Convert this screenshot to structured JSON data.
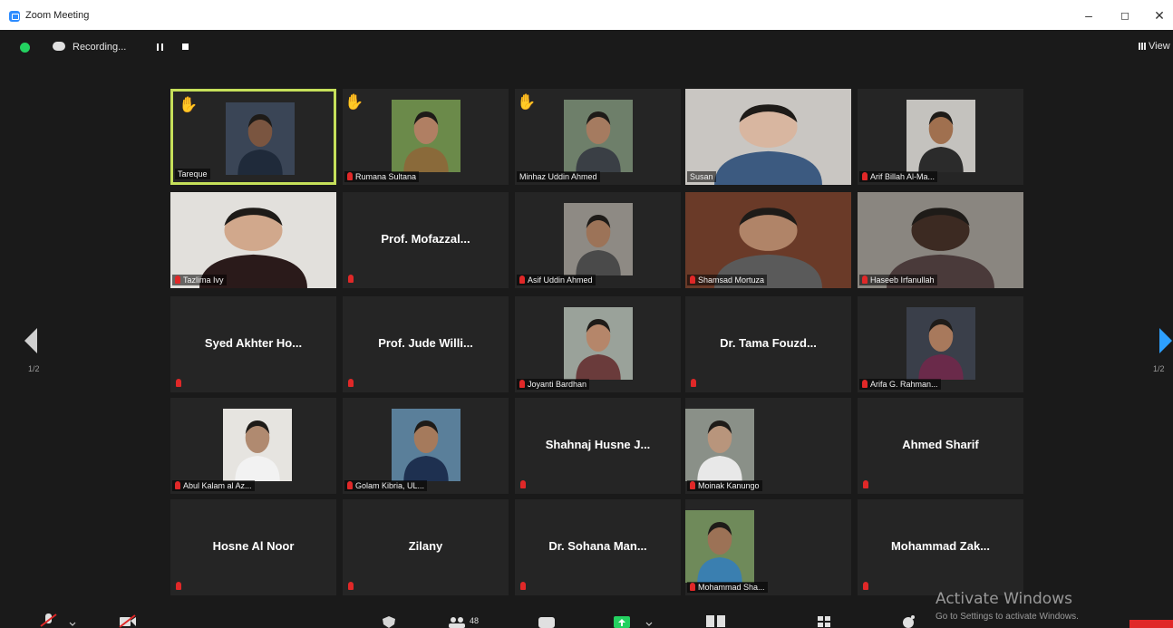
{
  "window": {
    "title": "Zoom Meeting",
    "minimize": "–",
    "restore": "◻",
    "close": "✕"
  },
  "meeting_bar": {
    "recording_label": "Recording...",
    "view_label": "View"
  },
  "pagination": {
    "left_label": "1/2",
    "right_label": "1/2"
  },
  "participants": [
    {
      "name": "Tareque",
      "hand": true,
      "active": true,
      "muted": false,
      "video": true,
      "bg": "#3a4556",
      "skin": "#7a5540",
      "shirt": "#1f2a3a"
    },
    {
      "name": "Rumana Sultana",
      "hand": true,
      "muted": true,
      "video": true,
      "bg": "#6b8a4a",
      "skin": "#b07f63",
      "shirt": "#8a6a3a"
    },
    {
      "name": "Minhaz Uddin Ahmed",
      "hand": true,
      "muted": false,
      "video": true,
      "bg": "#6e7f6a",
      "skin": "#a57b60",
      "shirt": "#3a3f45"
    },
    {
      "name": "Susan",
      "muted": false,
      "video": true,
      "full": true,
      "bg": "#c9c6c2",
      "skin": "#d8b6a0",
      "shirt": "#3c5a80"
    },
    {
      "name": "Arif Billah Al-Ma...",
      "muted": true,
      "video": true,
      "bg": "#c4c2be",
      "skin": "#a0704f",
      "shirt": "#2b2b2b"
    },
    {
      "name": "Tazlima Ivy",
      "muted": true,
      "video": true,
      "full": true,
      "bg": "#e2e0dc",
      "skin": "#d1a88c",
      "shirt": "#2a1a1a"
    },
    {
      "name": "Prof. Mofazzal...",
      "muted": true,
      "video": false
    },
    {
      "name": "Asif Uddin Ahmed",
      "muted": true,
      "video": true,
      "bg": "#8e8a84",
      "skin": "#9c7358",
      "shirt": "#4a4a4a"
    },
    {
      "name": "Shamsad Mortuza",
      "muted": true,
      "video": true,
      "full": true,
      "bg": "#6a3a28",
      "skin": "#b08468",
      "shirt": "#5a5a5a"
    },
    {
      "name": "Haseeb Irfanullah",
      "muted": true,
      "video": true,
      "full": true,
      "bg": "#8a8680",
      "skin": "#3c2a22",
      "shirt": "#4a3a3a"
    },
    {
      "name": "Syed Akhter Ho...",
      "muted": true,
      "video": false
    },
    {
      "name": "Prof. Jude Willi...",
      "muted": true,
      "video": false
    },
    {
      "name": "Joyanti Bardhan",
      "muted": true,
      "video": true,
      "bg": "#9aa29a",
      "skin": "#b5866a",
      "shirt": "#6a3b3b"
    },
    {
      "name": "Dr. Tama Fouzd...",
      "muted": true,
      "video": false
    },
    {
      "name": "Arifa G. Rahman...",
      "muted": true,
      "video": true,
      "bg": "#3a3f4a",
      "skin": "#a8795c",
      "shirt": "#6a2a4a"
    },
    {
      "name": "Abul Kalam al Az...",
      "muted": true,
      "video": true,
      "bg": "#e6e4e0",
      "skin": "#b08a70",
      "shirt": "#f2f2f2"
    },
    {
      "name": "Golam Kibria, UL...",
      "muted": true,
      "video": true,
      "bg": "#5a7f9a",
      "skin": "#a57a5c",
      "shirt": "#1e3050"
    },
    {
      "name": "Shahnaj Husne J...",
      "muted": true,
      "video": false
    },
    {
      "name": "Moinak Kanungo",
      "muted": true,
      "video": true,
      "bg": "#8a9088",
      "skin": "#b8957c",
      "shirt": "#e8e8e8"
    },
    {
      "name": "Ahmed Sharif",
      "muted": true,
      "video": false
    },
    {
      "name": "Hosne Al Noor",
      "muted": true,
      "video": false
    },
    {
      "name": "Zilany",
      "muted": true,
      "video": false
    },
    {
      "name": "Dr. Sohana Man...",
      "muted": true,
      "video": false
    },
    {
      "name": "Mohammad Sha...",
      "muted": true,
      "video": true,
      "bg": "#6f8a5a",
      "skin": "#9c7256",
      "shirt": "#3a7fb0"
    },
    {
      "name": "Mohammad Zak...",
      "muted": true,
      "video": false
    }
  ],
  "watermark": {
    "line1": "Activate Windows",
    "line2": "Go to Settings to activate Windows."
  },
  "toolbar": {
    "participants_count": "48"
  }
}
